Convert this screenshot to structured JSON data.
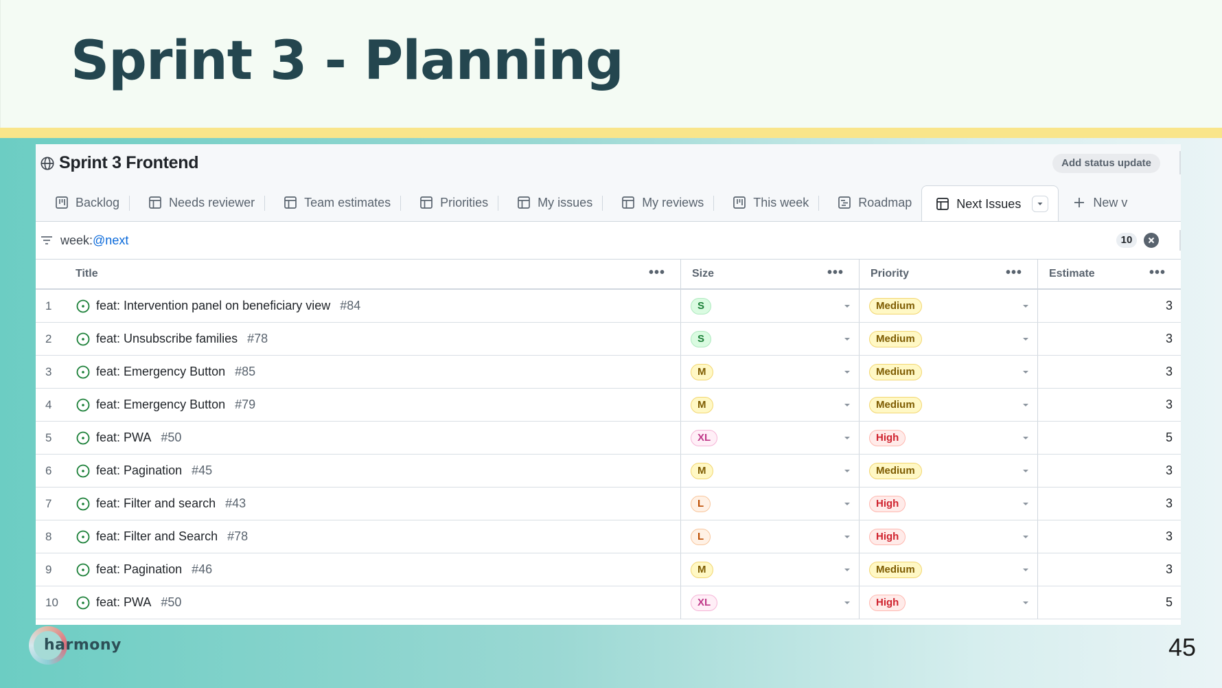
{
  "slide": {
    "title": "Sprint 3 - Planning",
    "page_number": "45",
    "logo_text": "harmony"
  },
  "project": {
    "title": "Sprint 3 Frontend",
    "status_button": "Add status update"
  },
  "tabs": [
    {
      "label": "Backlog",
      "icon": "board-icon"
    },
    {
      "label": "Needs reviewer",
      "icon": "table-icon"
    },
    {
      "label": "Team estimates",
      "icon": "table-icon"
    },
    {
      "label": "Priorities",
      "icon": "table-icon"
    },
    {
      "label": "My issues",
      "icon": "table-icon"
    },
    {
      "label": "My reviews",
      "icon": "table-icon"
    },
    {
      "label": "This week",
      "icon": "board-icon"
    },
    {
      "label": "Roadmap",
      "icon": "roadmap-icon"
    },
    {
      "label": "Next Issues",
      "icon": "table-icon",
      "active": true
    },
    {
      "label": "New v",
      "icon": "plus-icon"
    }
  ],
  "filter": {
    "prefix": "week:",
    "value": "@next",
    "count": "10"
  },
  "columns": {
    "title": "Title",
    "size": "Size",
    "priority": "Priority",
    "estimate": "Estimate"
  },
  "rows": [
    {
      "num": "1",
      "title": "feat: Intervention panel on beneficiary view",
      "number": "#84",
      "size": "S",
      "priority": "Medium",
      "estimate": "3"
    },
    {
      "num": "2",
      "title": "feat: Unsubscribe families",
      "number": "#78",
      "size": "S",
      "priority": "Medium",
      "estimate": "3"
    },
    {
      "num": "3",
      "title": "feat: Emergency Button",
      "number": "#85",
      "size": "M",
      "priority": "Medium",
      "estimate": "3"
    },
    {
      "num": "4",
      "title": "feat: Emergency Button",
      "number": "#79",
      "size": "M",
      "priority": "Medium",
      "estimate": "3"
    },
    {
      "num": "5",
      "title": "feat: PWA",
      "number": "#50",
      "size": "XL",
      "priority": "High",
      "estimate": "5"
    },
    {
      "num": "6",
      "title": "feat: Pagination",
      "number": "#45",
      "size": "M",
      "priority": "Medium",
      "estimate": "3"
    },
    {
      "num": "7",
      "title": "feat: Filter and search",
      "number": "#43",
      "size": "L",
      "priority": "High",
      "estimate": "3"
    },
    {
      "num": "8",
      "title": "feat: Filter and Search",
      "number": "#78",
      "size": "L",
      "priority": "High",
      "estimate": "3"
    },
    {
      "num": "9",
      "title": "feat: Pagination",
      "number": "#46",
      "size": "M",
      "priority": "Medium",
      "estimate": "3"
    },
    {
      "num": "10",
      "title": "feat: PWA",
      "number": "#50",
      "size": "XL",
      "priority": "High",
      "estimate": "5"
    }
  ],
  "colors": {
    "title": "#24464f",
    "accent_bar": "#f9e58a",
    "open_issue": "#1a7f37",
    "link": "#0969da"
  }
}
